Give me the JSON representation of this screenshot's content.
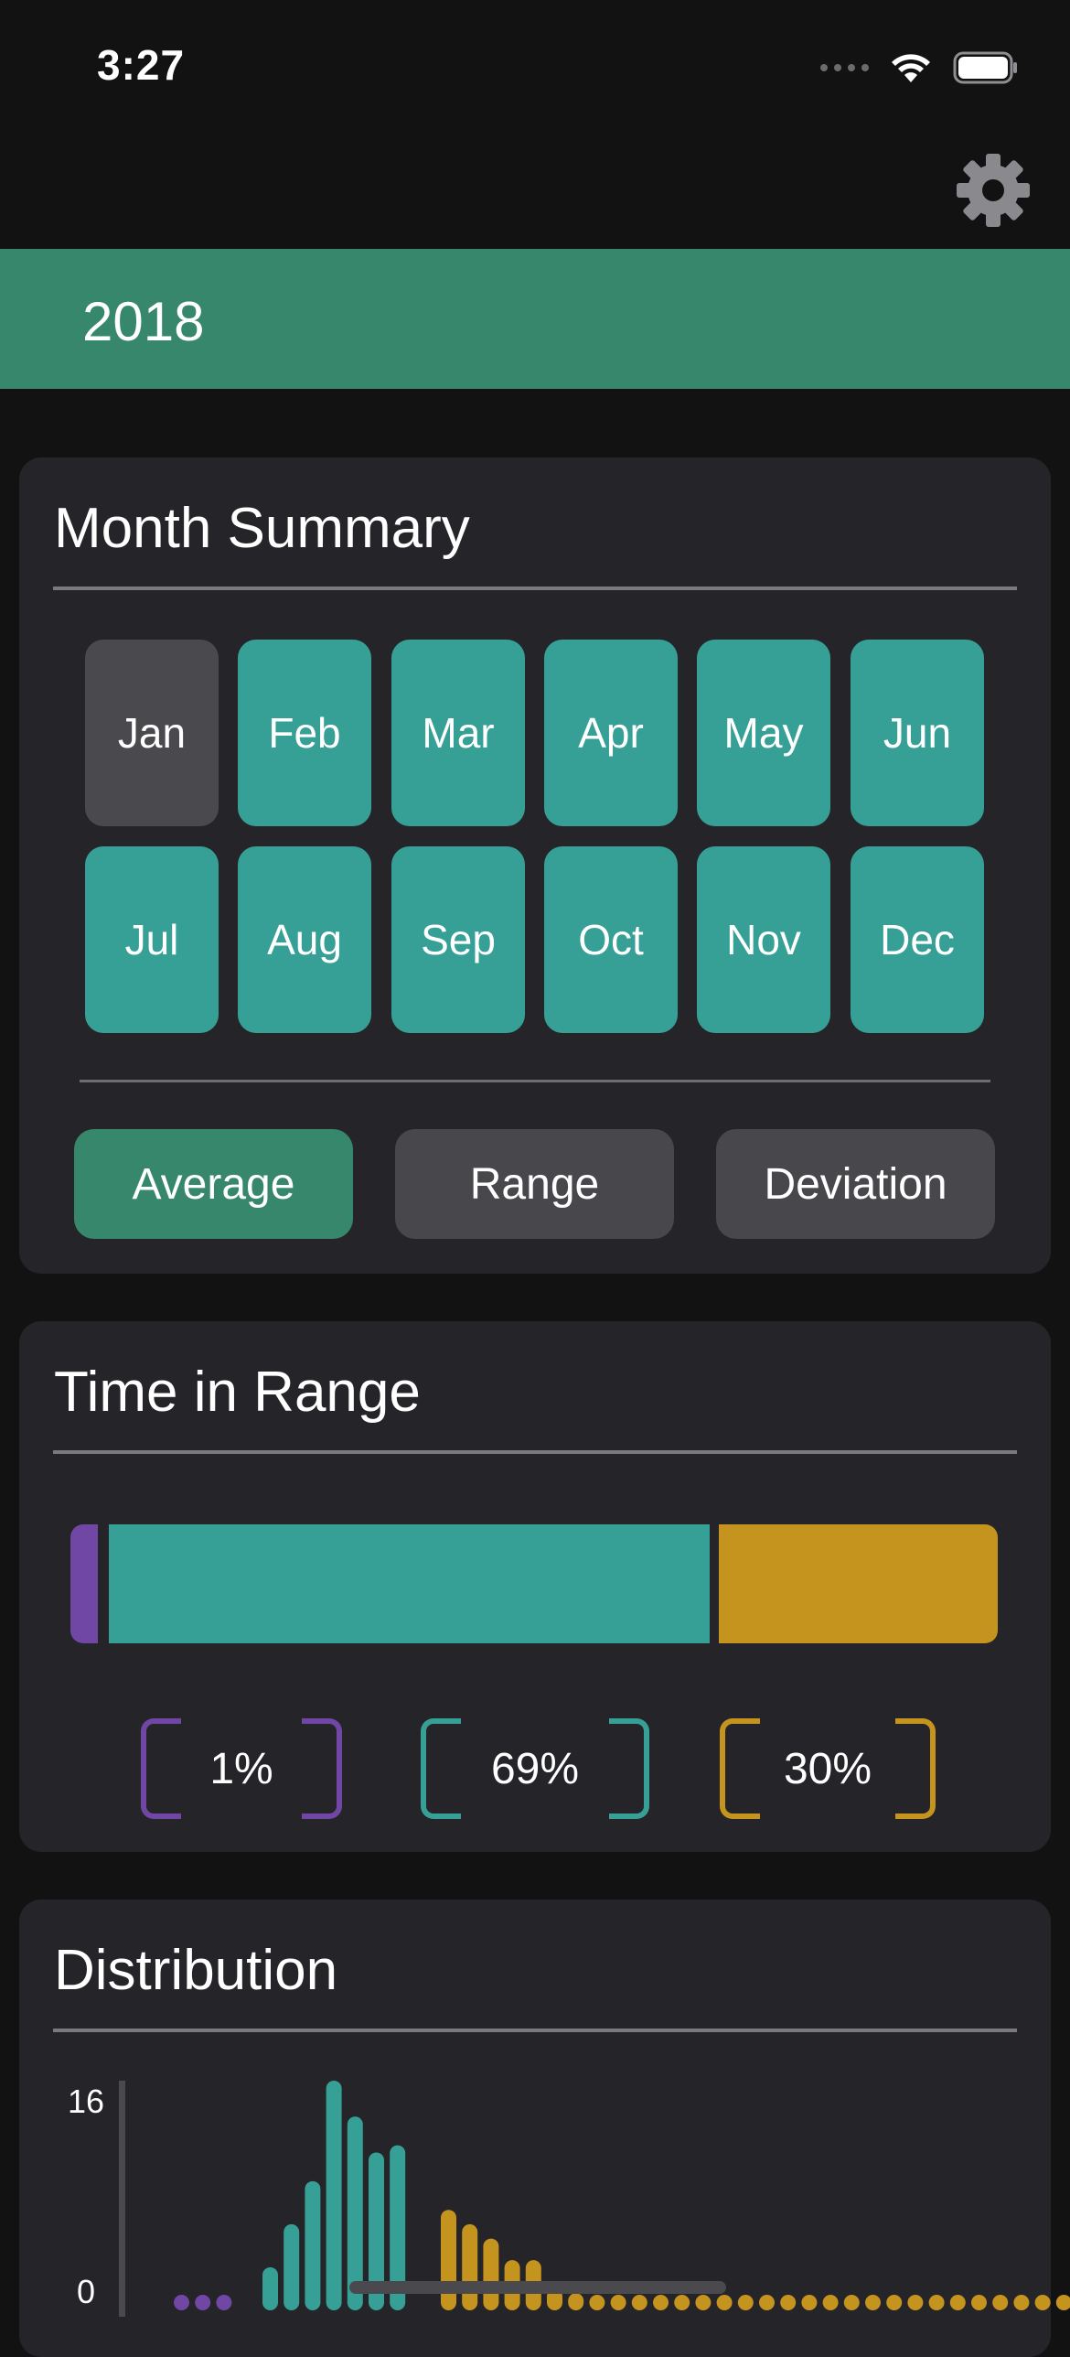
{
  "status_bar": {
    "time": "3:27"
  },
  "header": {
    "settings_icon": "gear-icon"
  },
  "year_bar": {
    "year": "2018"
  },
  "month_summary": {
    "title": "Month Summary",
    "months": [
      "Jan",
      "Feb",
      "Mar",
      "Apr",
      "May",
      "Jun",
      "Jul",
      "Aug",
      "Sep",
      "Oct",
      "Nov",
      "Dec"
    ],
    "selected_month": "Jan",
    "modes": [
      "Average",
      "Range",
      "Deviation"
    ],
    "active_mode": "Average"
  },
  "time_in_range": {
    "title": "Time in Range",
    "low": {
      "percent": 1,
      "label": "1%",
      "color": "#7047a4"
    },
    "in": {
      "percent": 69,
      "label": "69%",
      "color": "#37a096"
    },
    "high": {
      "percent": 30,
      "label": "30%",
      "color": "#c5941f"
    }
  },
  "distribution": {
    "title": "Distribution",
    "y_max_label": "16",
    "y_min_label": "0",
    "colors": {
      "low": "#7047a4",
      "in": "#37a096",
      "high": "#c5941f"
    }
  },
  "chart_data": {
    "type": "bar",
    "ylim": [
      0,
      16
    ],
    "series": [
      {
        "values": [
          0,
          0,
          0
        ]
      },
      {
        "values": [
          3,
          6,
          9,
          16,
          13.5,
          11,
          11.5
        ]
      },
      {
        "values": [
          7,
          6,
          5,
          3.5,
          3.5,
          1.5,
          1.2,
          1,
          1,
          1,
          1,
          1,
          1,
          1,
          1,
          1,
          1,
          1,
          1,
          1,
          1,
          1,
          1,
          1,
          1,
          1,
          1,
          1,
          1,
          1,
          1,
          1
        ]
      }
    ]
  }
}
